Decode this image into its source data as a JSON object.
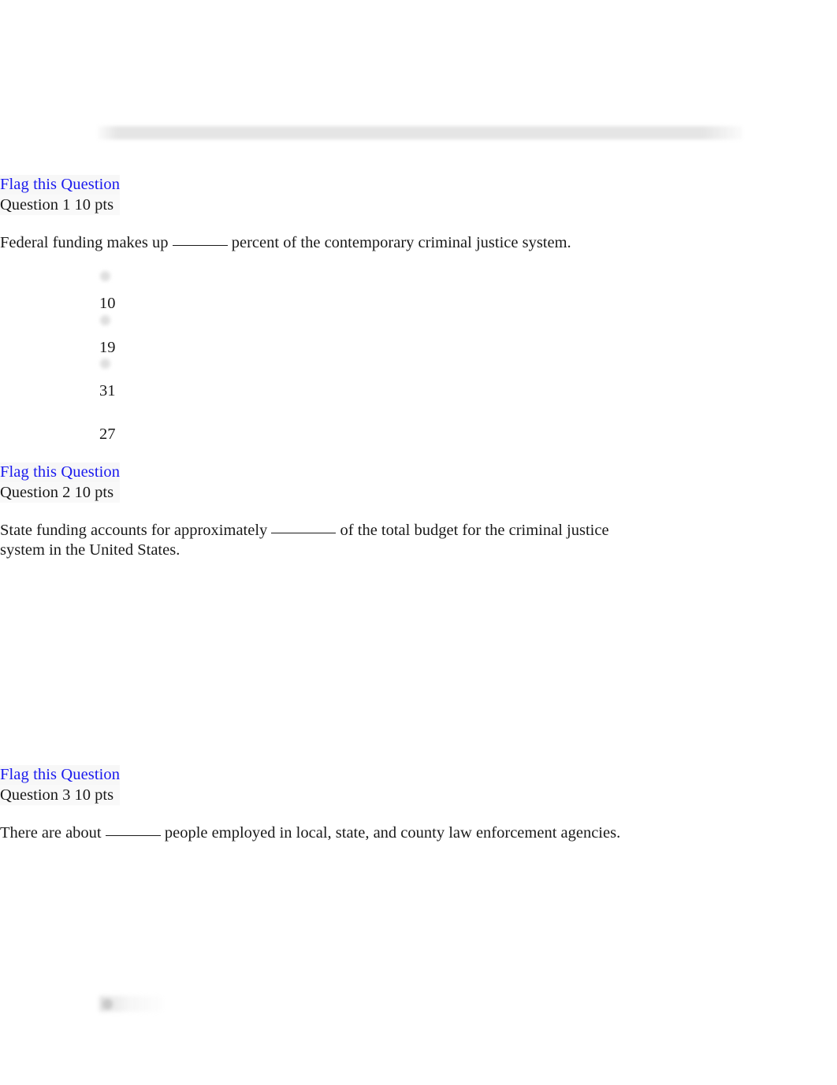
{
  "document": {
    "type": "quiz",
    "background_color": "#ffffff",
    "text_color": "#1a1a1a",
    "link_color": "#1a1aee"
  },
  "header_band": {
    "name": "faded-header-bar",
    "color": "#e4e4e4"
  },
  "questions": [
    {
      "flag_label": "Flag this Question",
      "heading": "Question 1 10 pts",
      "number": "1",
      "points": "10 pts",
      "text_before_blank": "Federal funding makes up",
      "text_after_blank": "percent of the contemporary criminal justice system.",
      "options": [
        {
          "label": "10",
          "has_radio": true
        },
        {
          "label": "19",
          "has_radio": true
        },
        {
          "label": "31",
          "has_radio": true
        },
        {
          "label": "27",
          "has_radio": false
        }
      ]
    },
    {
      "flag_label": "Flag this Question",
      "heading": "Question 2 10 pts",
      "number": "2",
      "points": "10 pts",
      "text_before_blank": "State funding accounts for approximately",
      "text_after_blank": "of the total budget for the criminal justice system in the United States.",
      "options": []
    },
    {
      "flag_label": "Flag this Question",
      "heading": "Question 3 10 pts",
      "number": "3",
      "points": "10 pts",
      "text_before_blank": "There are about",
      "text_after_blank": "people employed in local, state, and county law enforcement agencies.",
      "options": []
    }
  ]
}
